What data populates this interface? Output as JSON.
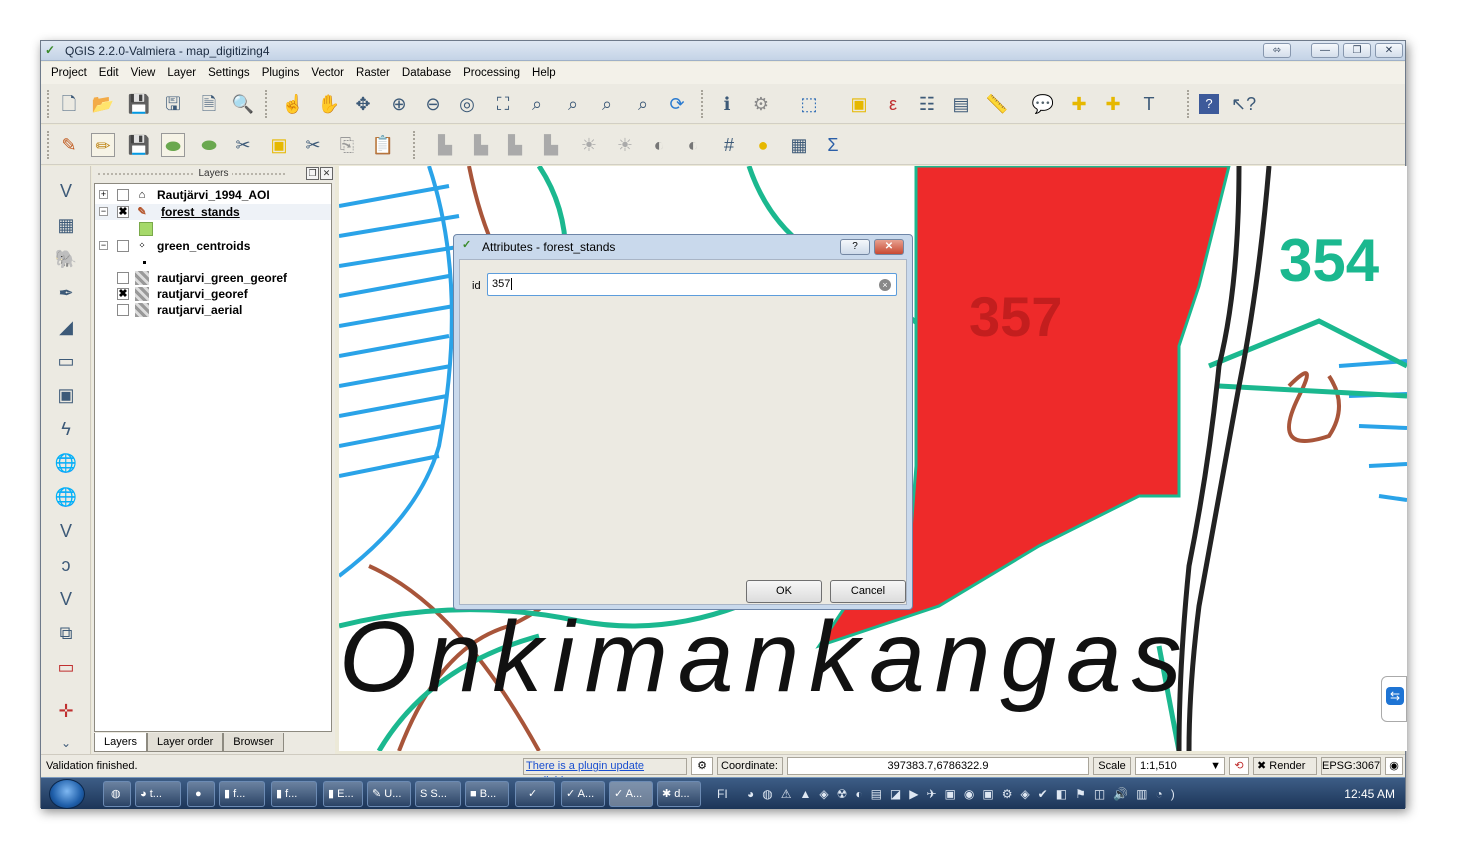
{
  "window": {
    "title": "QGIS 2.2.0-Valmiera - map_digitizing4",
    "controls": {
      "restore": "⬄",
      "minimize": "—",
      "maximize": "❐",
      "close": "✕"
    }
  },
  "menu": [
    "Project",
    "Edit",
    "View",
    "Layer",
    "Settings",
    "Plugins",
    "Vector",
    "Raster",
    "Database",
    "Processing",
    "Help"
  ],
  "toolbar_icons": {
    "row1": [
      "new-project-icon",
      "open-project-icon",
      "save-project-icon",
      "save-as-icon",
      "new-print-composer-icon",
      "composer-manager-icon",
      "touch-zoom-icon",
      "pan-icon",
      "pan-to-selection-icon",
      "zoom-in-icon",
      "zoom-out-icon",
      "zoom-native-icon",
      "zoom-full-icon",
      "zoom-selection-icon",
      "zoom-layer-icon",
      "zoom-last-icon",
      "zoom-next-icon",
      "refresh-icon",
      "identify-icon",
      "action-icon",
      "select-features-icon",
      "deselect-icon",
      "field-calculator-icon",
      "attribute-table-icon",
      "statistics-icon",
      "measure-icon",
      "map-tips-icon",
      "new-bookmark-icon",
      "show-bookmarks-icon",
      "text-annotation-icon",
      "help-icon",
      "whats-this-icon"
    ],
    "row2": [
      "current-edits-icon",
      "toggle-editing-icon",
      "save-layer-edits-icon",
      "add-feature-icon",
      "move-feature-icon",
      "node-tool-icon",
      "delete-selected-icon",
      "cut-features-icon",
      "copy-features-icon",
      "paste-features-icon"
    ]
  },
  "layers_panel": {
    "title": "Layers",
    "items": [
      {
        "name": "Rautjärvi_1994_AOI",
        "checked": false,
        "expander": "+"
      },
      {
        "name": "forest_stands",
        "checked": true,
        "expander": "−"
      },
      {
        "name": "green_centroids",
        "checked": false,
        "expander": "−"
      },
      {
        "name": "rautjarvi_green_georef",
        "checked": false
      },
      {
        "name": "rautjarvi_georef",
        "checked": true
      },
      {
        "name": "rautjarvi_aerial",
        "checked": false
      }
    ],
    "check_mark": "✖",
    "tabs": [
      "Layers",
      "Layer order",
      "Browser"
    ]
  },
  "map": {
    "labels": {
      "stand_357": "357",
      "stand_354": "354",
      "place": "Onkimankangas"
    },
    "colors": {
      "polygon_fill": "#ee2a2a",
      "teal_lines": "#1bb88f",
      "blue_lines": "#2aa3e8",
      "brown_lines": "#a8553a"
    }
  },
  "dialog": {
    "title": "Attributes - forest_stands",
    "help_button": "?",
    "close_button": "✕",
    "field_label": "id",
    "field_value": "357",
    "clear_glyph": "×",
    "ok": "OK",
    "cancel": "Cancel"
  },
  "status_bar": {
    "message": "Validation finished.",
    "plugin_link": "There is a plugin update available",
    "coordinate_label": "Coordinate:",
    "coordinate_value": "397383.7,6786322.9",
    "scale_label": "Scale",
    "scale_value": "1:1,510",
    "render_label": "Render",
    "crs": "EPSG:3067"
  },
  "taskbar": {
    "items": [
      "t...",
      "f...",
      "f...",
      "E...",
      "U...",
      "S...",
      "B...",
      "A...",
      "A...",
      "d..."
    ],
    "lang": "FI",
    "clock": "12:45 AM"
  }
}
